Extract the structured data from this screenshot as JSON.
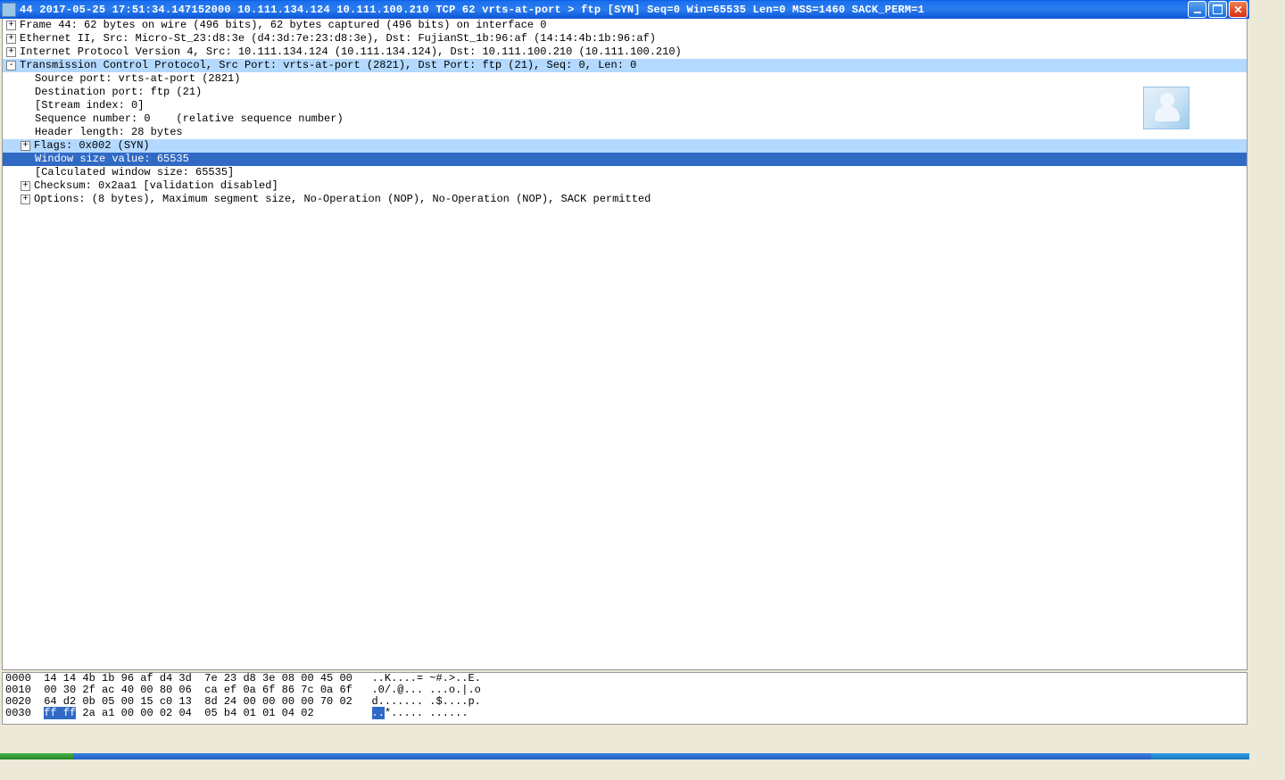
{
  "title": "44 2017-05-25 17:51:34.147152000 10.111.134.124 10.111.100.210 TCP 62 vrts-at-port > ftp [SYN] Seq=0 Win=65535 Len=0 MSS=1460 SACK_PERM=1",
  "tree": {
    "frame": "Frame 44: 62 bytes on wire (496 bits), 62 bytes captured (496 bits) on interface 0",
    "ethernet": "Ethernet II, Src: Micro-St_23:d8:3e (d4:3d:7e:23:d8:3e), Dst: FujianSt_1b:96:af (14:14:4b:1b:96:af)",
    "ip": "Internet Protocol Version 4, Src: 10.111.134.124 (10.111.134.124), Dst: 10.111.100.210 (10.111.100.210)",
    "tcp": "Transmission Control Protocol, Src Port: vrts-at-port (2821), Dst Port: ftp (21), Seq: 0, Len: 0",
    "srcport": "Source port: vrts-at-port (2821)",
    "dstport": "Destination port: ftp (21)",
    "stream": "[Stream index: 0]",
    "seq": "Sequence number: 0    (relative sequence number)",
    "hdrlen": "Header length: 28 bytes",
    "flags": "Flags: 0x002 (SYN)",
    "winsize": "Window size value: 65535",
    "calcwin": "[Calculated window size: 65535]",
    "checksum": "Checksum: 0x2aa1 [validation disabled]",
    "options": "Options: (8 bytes), Maximum segment size, No-Operation (NOP), No-Operation (NOP), SACK permitted"
  },
  "hex": {
    "r0": "0000  14 14 4b 1b 96 af d4 3d  7e 23 d8 3e 08 00 45 00   ..K....= ~#.>..E.",
    "r1": "0010  00 30 2f ac 40 00 80 06  ca ef 0a 6f 86 7c 0a 6f   .0/.@... ...o.|.o",
    "r2": "0020  64 d2 0b 05 00 15 c0 13  8d 24 00 00 00 00 70 02   d....... .$....p.",
    "r3_pre": "0030  ",
    "r3_sel": "ff ff",
    "r3_post": " 2a a1 00 00 02 04  05 b4 01 01 04 02         ",
    "r3_ascii_sel": "..",
    "r3_ascii_post": "*..... ......"
  }
}
